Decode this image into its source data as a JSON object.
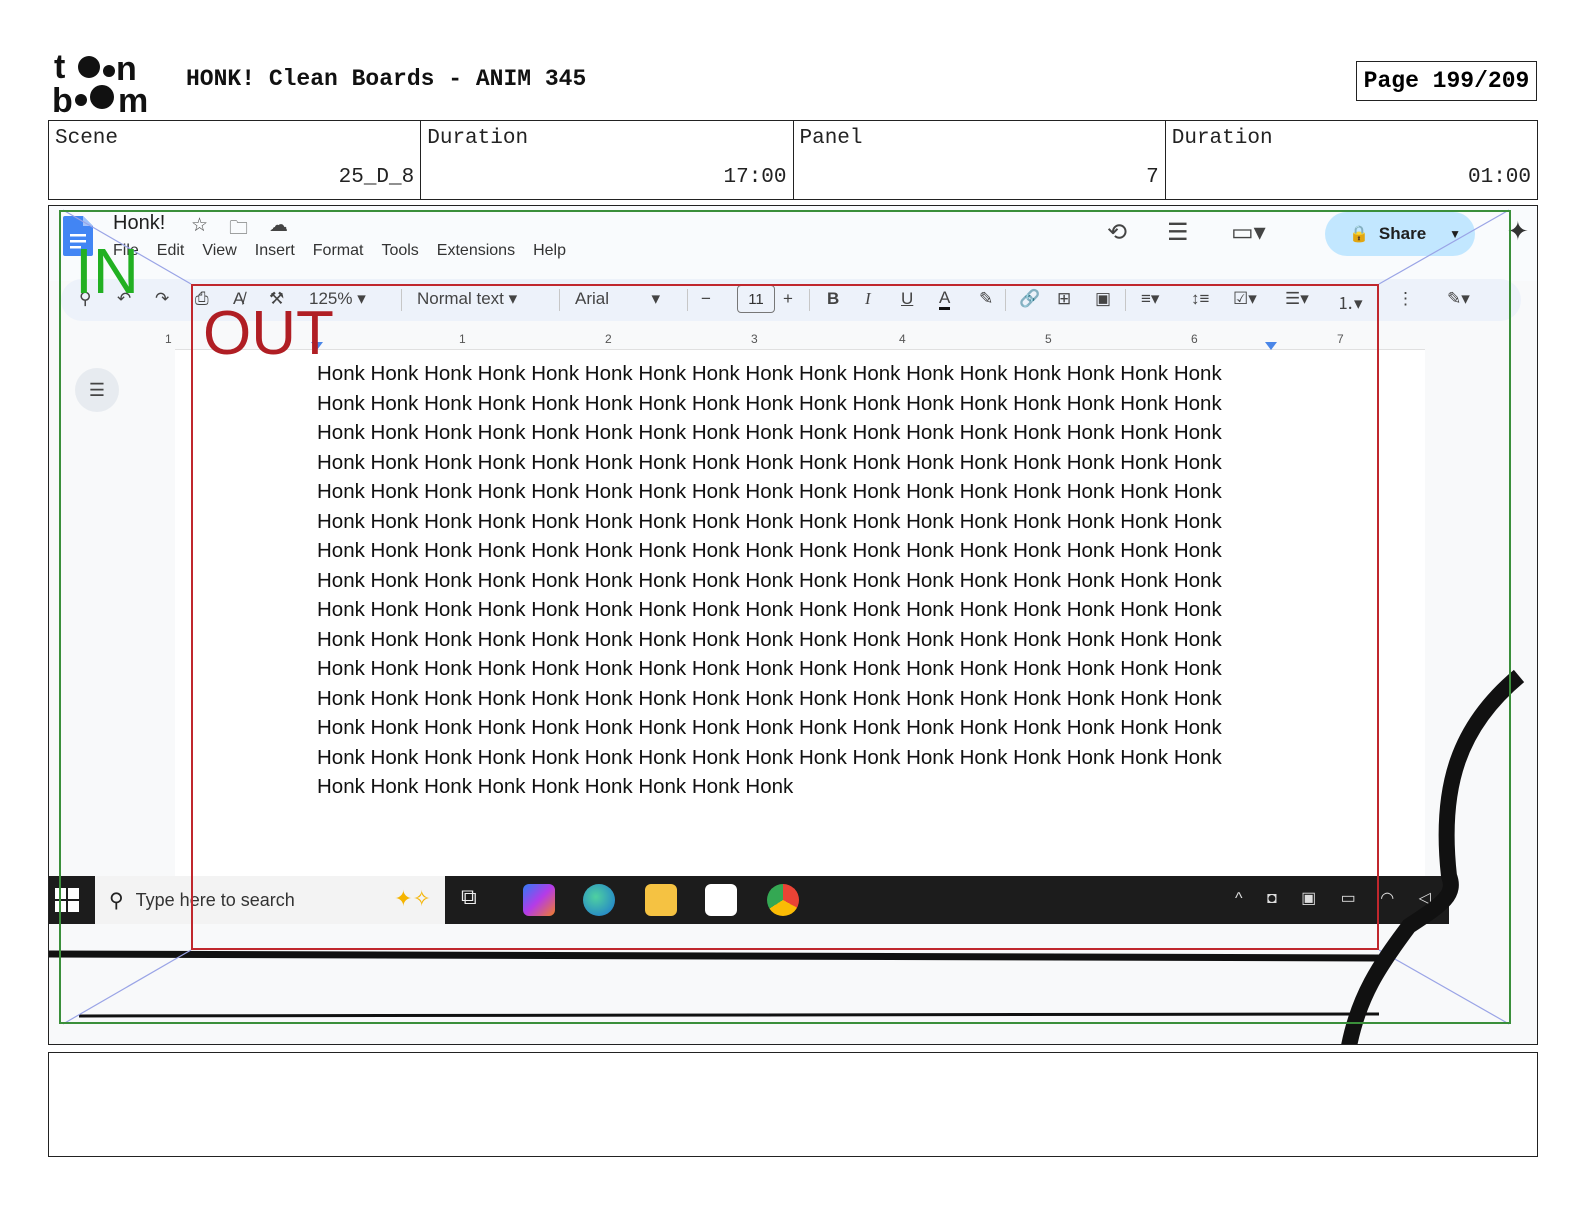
{
  "board": {
    "title": "HONK! Clean Boards - ANIM 345",
    "page": "Page 199/209",
    "logo_text": "toon boom"
  },
  "info": {
    "scene_label": "Scene",
    "scene_value": "25_D_8",
    "duration_label": "Duration",
    "duration_value": "17:00",
    "panel_label": "Panel",
    "panel_value": "7",
    "panel_duration_label": "Duration",
    "panel_duration_value": "01:00"
  },
  "frame_labels": {
    "in": "IN",
    "out": "OUT"
  },
  "docs": {
    "doc_name": "Honk!",
    "menu": [
      "File",
      "Edit",
      "View",
      "Insert",
      "Format",
      "Tools",
      "Extensions",
      "Help"
    ],
    "share_label": "Share",
    "zoom": "125%",
    "style": "Normal text",
    "font": "Arial",
    "font_size": "11",
    "ruler_numbers": [
      "1",
      "1",
      "2",
      "3",
      "4",
      "5",
      "6",
      "7"
    ],
    "body_text": "Honk Honk Honk Honk Honk Honk Honk Honk Honk Honk Honk Honk Honk Honk Honk Honk Honk Honk Honk Honk Honk Honk Honk Honk Honk Honk Honk Honk Honk Honk Honk Honk Honk Honk Honk Honk Honk Honk Honk Honk Honk Honk Honk Honk Honk Honk Honk Honk Honk Honk Honk Honk Honk Honk Honk Honk Honk Honk Honk Honk Honk Honk Honk Honk Honk Honk Honk Honk Honk Honk Honk Honk Honk Honk Honk Honk Honk Honk Honk Honk Honk Honk Honk Honk Honk Honk Honk Honk Honk Honk Honk Honk Honk Honk Honk Honk Honk Honk Honk Honk Honk Honk Honk Honk Honk Honk Honk Honk Honk Honk Honk Honk Honk Honk Honk Honk Honk Honk Honk Honk Honk Honk Honk Honk Honk Honk Honk Honk Honk Honk Honk Honk Honk Honk Honk Honk Honk Honk Honk Honk Honk Honk Honk Honk Honk Honk Honk Honk Honk Honk Honk Honk Honk Honk Honk Honk Honk Honk Honk Honk Honk Honk Honk Honk Honk Honk Honk Honk Honk Honk Honk Honk Honk Honk Honk Honk Honk Honk Honk Honk Honk Honk Honk Honk Honk Honk Honk Honk Honk Honk Honk Honk Honk Honk Honk Honk Honk Honk Honk Honk Honk Honk Honk Honk Honk Honk Honk Honk Honk Honk Honk Honk Honk Honk Honk Honk Honk Honk Honk Honk Honk Honk Honk Honk Honk Honk Honk Honk Honk Honk Honk Honk Honk Honk Honk Honk Honk Honk Honk Honk Honk Honk Honk Honk Honk Honk Honk"
  },
  "taskbar": {
    "search_placeholder": "Type here to search"
  },
  "colors": {
    "in_frame": "#3a8f3a",
    "out_frame": "#c0272d",
    "share_bg": "#c2e7ff"
  }
}
